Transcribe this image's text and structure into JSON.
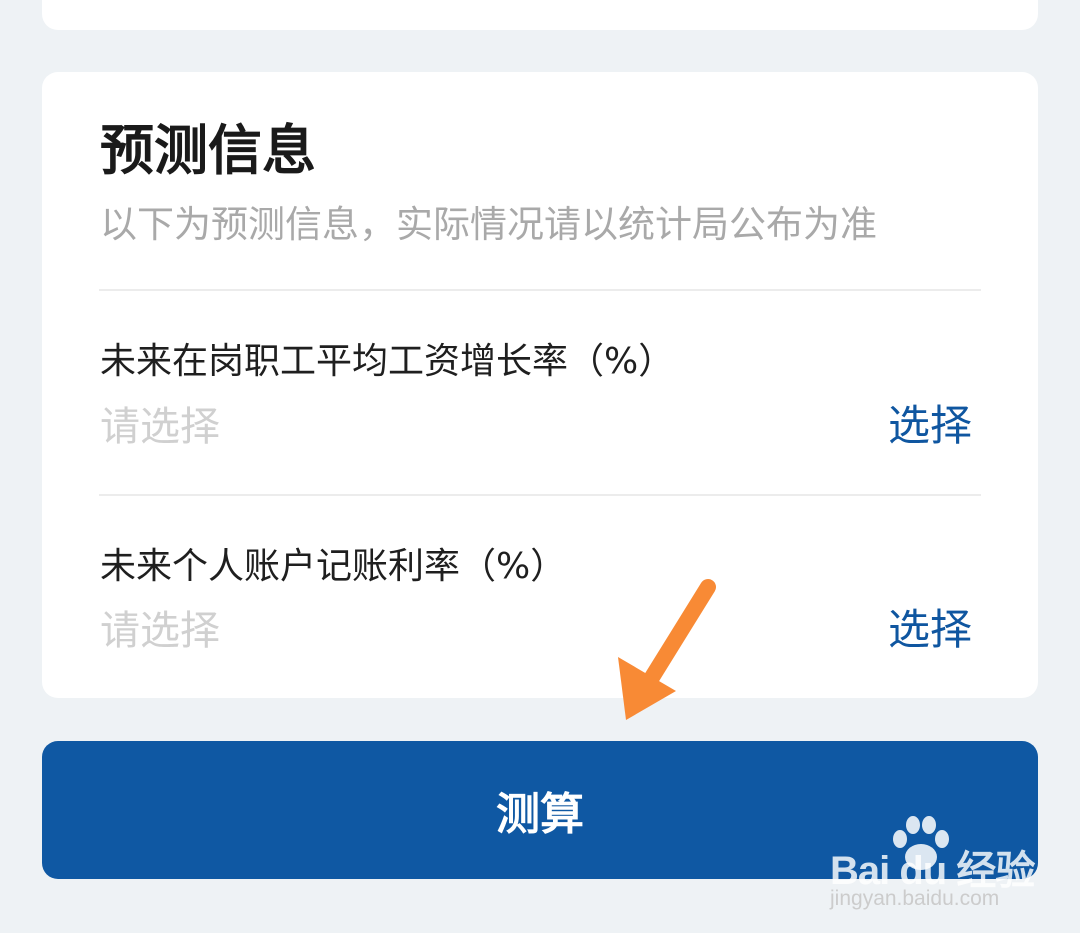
{
  "forecast": {
    "title": "预测信息",
    "subtitle": "以下为预测信息，实际情况请以统计局公布为准",
    "fields": [
      {
        "label": "未来在岗职工平均工资增长率（%）",
        "placeholder": "请选择",
        "action": "选择"
      },
      {
        "label": "未来个人账户记账利率（%）",
        "placeholder": "请选择",
        "action": "选择"
      }
    ]
  },
  "submit": {
    "label": "测算"
  },
  "annotation": {
    "arrow_color": "#f88a35"
  },
  "watermark": {
    "logo_text": "Bai du 经验",
    "url": "jingyan.baidu.com"
  },
  "colors": {
    "background": "#eef2f5",
    "card": "#ffffff",
    "accent": "#0f58a3",
    "placeholder": "#d0d0d0"
  }
}
